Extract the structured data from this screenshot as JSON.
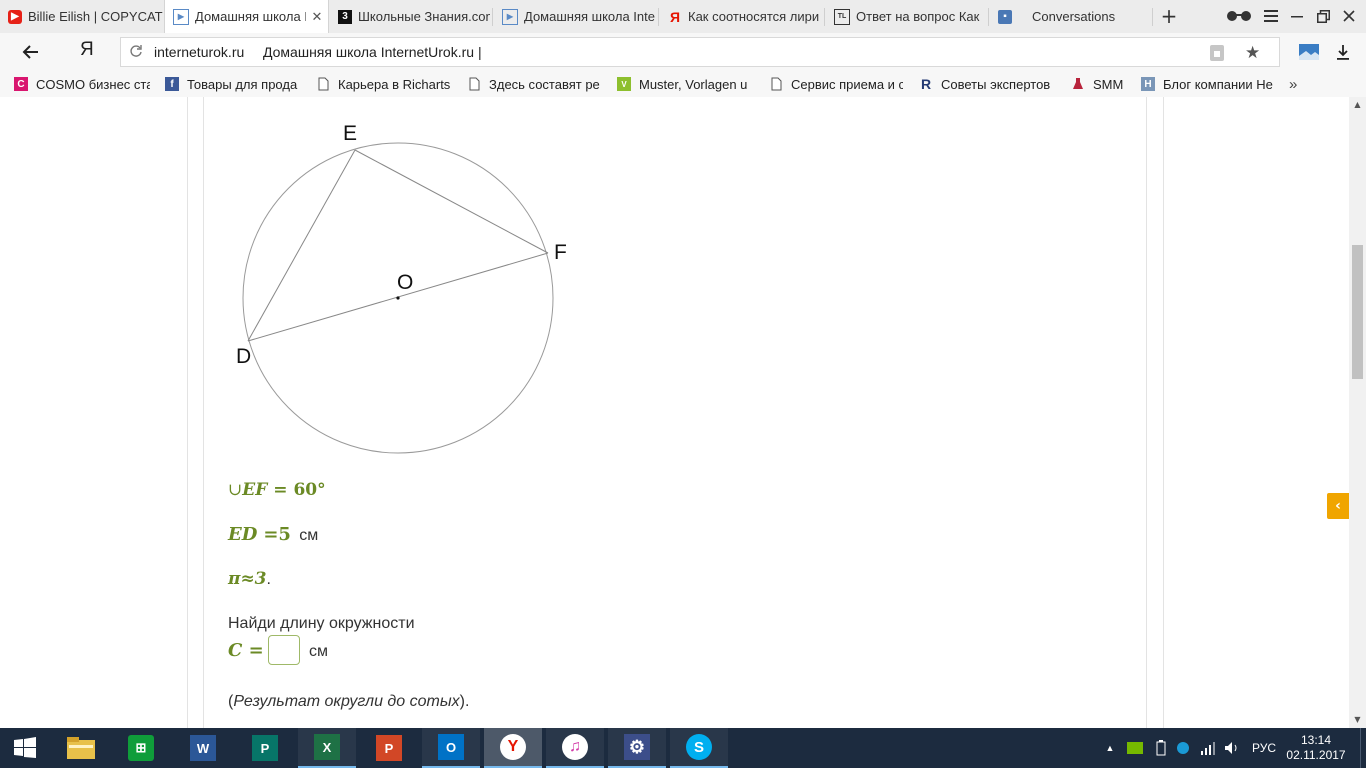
{
  "tabs": [
    {
      "title": "Billie Eilish | COPYCAT",
      "favicon": "youtube-icon"
    },
    {
      "title": "Домашняя школа I",
      "favicon": "internet-urok-icon",
      "active": true
    },
    {
      "title": "Школьные Знания.com",
      "favicon": "znanija-icon"
    },
    {
      "title": "Домашняя школа Inte",
      "favicon": "internet-urok-icon"
    },
    {
      "title": "Как соотносятся лири",
      "favicon": "yandex-icon"
    },
    {
      "title": "Ответ на вопрос Как",
      "favicon": "tl-icon"
    },
    {
      "title": "Conversations",
      "favicon": "chat-icon"
    }
  ],
  "address": {
    "domain": "interneturok.ru",
    "page_title": "Домашняя школа InternetUrok.ru |"
  },
  "bookmarks": [
    {
      "label": "COSMO бизнес ста",
      "icon": "cosmo-icon"
    },
    {
      "label": "Товары для прода",
      "icon": "facebook-icon"
    },
    {
      "label": "Карьера в Richarts",
      "icon": "page-icon"
    },
    {
      "label": "Здесь составят ре",
      "icon": "page-icon"
    },
    {
      "label": "Muster, Vorlagen u",
      "icon": "vorlagen-icon"
    },
    {
      "label": "Сервис приема и с",
      "icon": "page-icon"
    },
    {
      "label": "Советы экспертов",
      "icon": "r-icon"
    },
    {
      "label": "SMM",
      "icon": "flask-icon"
    },
    {
      "label": "Блог компании Не",
      "icon": "h-icon"
    }
  ],
  "figure": {
    "labels": {
      "E": "E",
      "F": "F",
      "O": "O",
      "D": "D"
    }
  },
  "task": {
    "arc_prefix": "∪",
    "arc_name": "EF",
    "arc_value": "= 60°",
    "chord_name": "ED",
    "chord_value": "=5",
    "chord_unit": "см",
    "pi_line": "π≈3",
    "pi_dot": ".",
    "question": "Найди длину окружности",
    "answer_var": "C =",
    "answer_unit": "см",
    "rounding_open": "(",
    "rounding_note": "Результат округли до сотых",
    "rounding_close": ")."
  },
  "taskbar": {
    "apps": [
      "start-icon",
      "file-explorer-icon",
      "store-icon",
      "word-icon",
      "publisher-icon",
      "excel-icon",
      "powerpoint-icon",
      "outlook-icon",
      "yandex-browser-icon",
      "itunes-icon",
      "settings-icon",
      "skype-icon"
    ],
    "language": "РУС",
    "time": "13:14",
    "date": "02.11.2017"
  }
}
